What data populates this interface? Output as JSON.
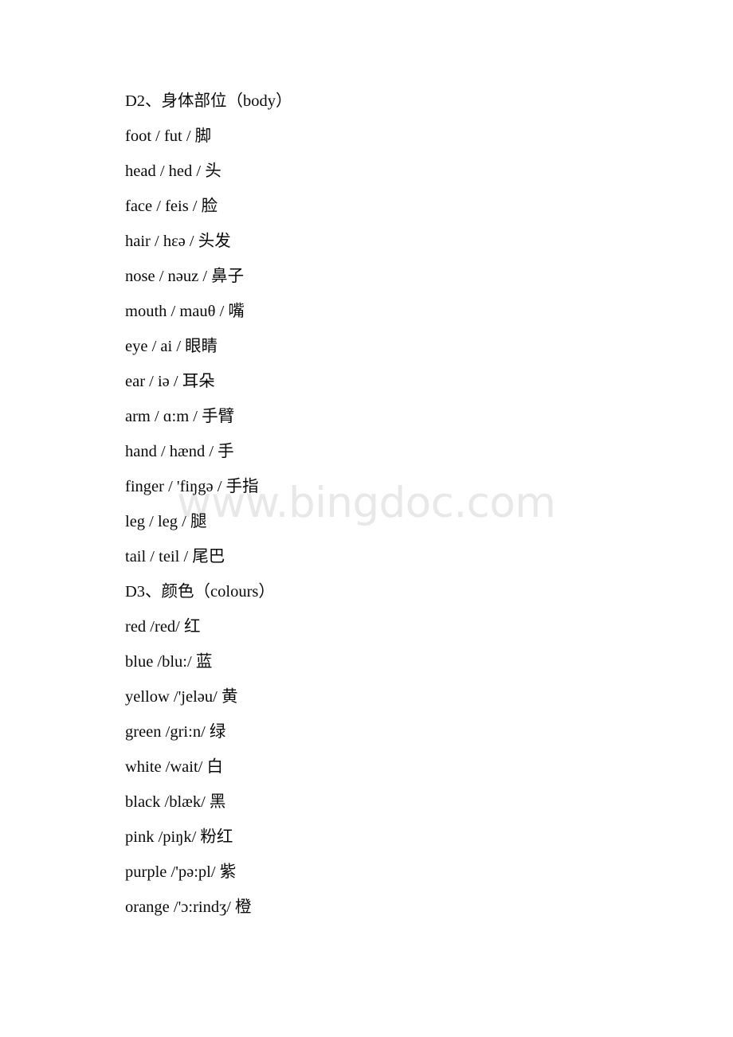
{
  "document": {
    "watermark": "www.bingdoc.com",
    "sections": [
      {
        "heading": "D2、身体部位（body）",
        "entries": [
          "foot / fut / 脚",
          "head / hed / 头",
          "face / feis / 脸",
          "hair / hɛə / 头发",
          "nose / nəuz / 鼻子",
          "mouth / mauθ / 嘴",
          "eye / ai / 眼睛",
          "ear / iə / 耳朵",
          "arm / ɑ:m / 手臂",
          "hand / hænd / 手",
          "finger / 'fiŋgə / 手指",
          "leg / leg / 腿",
          "tail / teil / 尾巴"
        ]
      },
      {
        "heading": "D3、颜色（colours）",
        "entries": [
          "red /red/ 红",
          "blue /blu:/ 蓝",
          "yellow /'jeləu/ 黄",
          "green /gri:n/ 绿",
          "white /wait/ 白",
          "black /blæk/ 黑",
          "pink /piŋk/ 粉红",
          "purple /'pə:pl/ 紫",
          "orange /'ɔ:rindʒ/ 橙"
        ]
      }
    ]
  }
}
